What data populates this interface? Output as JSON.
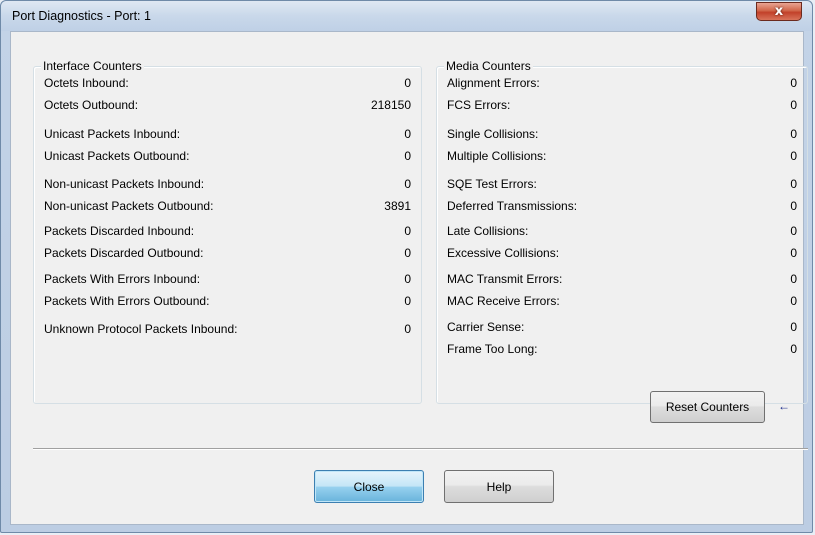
{
  "window": {
    "title": "Port Diagnostics - Port: 1",
    "close_glyph": "x"
  },
  "interface_counters": {
    "legend": "Interface Counters",
    "rows": [
      {
        "label": "Octets Inbound:",
        "value": "0"
      },
      {
        "label": "Octets Outbound:",
        "value": "218150"
      },
      {
        "label": "Unicast Packets Inbound:",
        "value": "0"
      },
      {
        "label": "Unicast Packets Outbound:",
        "value": "0"
      },
      {
        "label": "Non-unicast Packets Inbound:",
        "value": "0"
      },
      {
        "label": "Non-unicast Packets Outbound:",
        "value": "3891"
      },
      {
        "label": "Packets Discarded Inbound:",
        "value": "0"
      },
      {
        "label": "Packets Discarded Outbound:",
        "value": "0"
      },
      {
        "label": "Packets With Errors Inbound:",
        "value": "0"
      },
      {
        "label": "Packets With Errors Outbound:",
        "value": "0"
      },
      {
        "label": "Unknown Protocol Packets Inbound:",
        "value": "0"
      }
    ]
  },
  "media_counters": {
    "legend": "Media Counters",
    "rows": [
      {
        "label": "Alignment Errors:",
        "value": "0"
      },
      {
        "label": "FCS Errors:",
        "value": "0"
      },
      {
        "label": "Single Collisions:",
        "value": "0"
      },
      {
        "label": "Multiple Collisions:",
        "value": "0"
      },
      {
        "label": "SQE Test Errors:",
        "value": "0"
      },
      {
        "label": "Deferred Transmissions:",
        "value": "0"
      },
      {
        "label": "Late Collisions:",
        "value": "0"
      },
      {
        "label": "Excessive Collisions:",
        "value": "0"
      },
      {
        "label": "MAC Transmit Errors:",
        "value": "0"
      },
      {
        "label": "MAC Receive Errors:",
        "value": "0"
      },
      {
        "label": "Carrier Sense:",
        "value": "0"
      },
      {
        "label": "Frame Too Long:",
        "value": "0"
      }
    ]
  },
  "buttons": {
    "reset": "Reset Counters",
    "reset_arrow": "←",
    "close": "Close",
    "help": "Help"
  },
  "icons": {
    "close": "close-icon",
    "arrow": "arrow-left-icon"
  },
  "colors": {
    "title_bar": "#c9d8ea",
    "close_button": "#c2412a",
    "default_button": "#98d1ef",
    "arrow": "#1a2a8a"
  }
}
